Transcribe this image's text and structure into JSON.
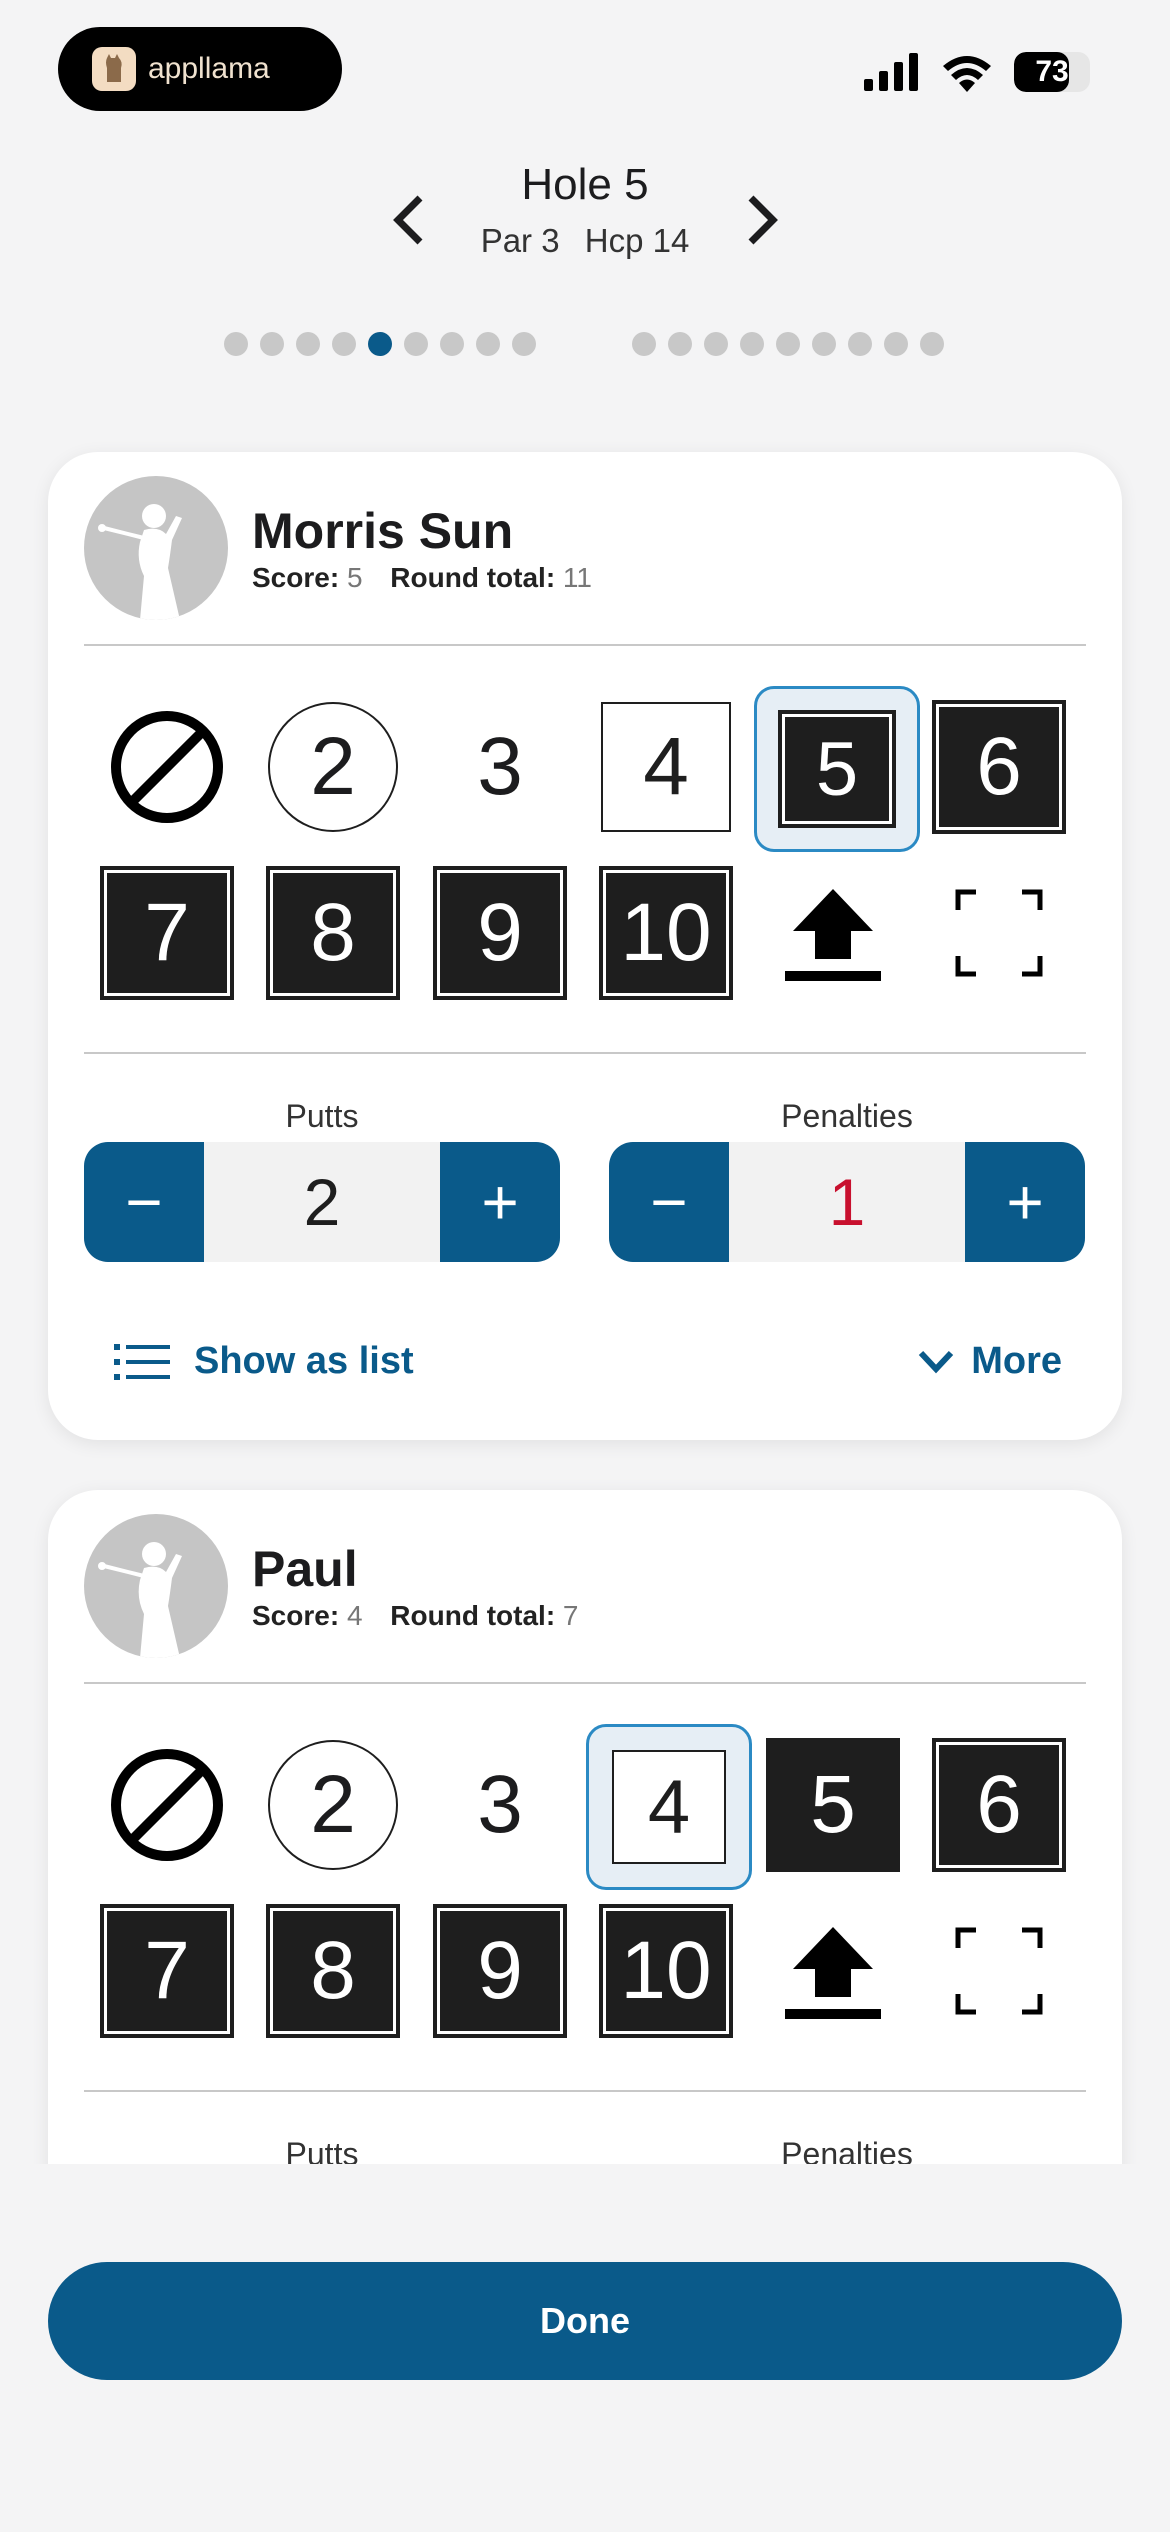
{
  "status": {
    "brand": "appllama",
    "battery": "73",
    "battery_level": 0.73
  },
  "hole": {
    "title": "Hole 5",
    "par": "Par 3",
    "hcp": "Hcp 14",
    "total_holes": 18,
    "current_index": 4
  },
  "players": [
    {
      "name": "Morris Sun",
      "score_label": "Score:",
      "score": "5",
      "round_label": "Round total:",
      "round_total": "11",
      "scores": [
        "2",
        "3",
        "4",
        "5",
        "6",
        "7",
        "8",
        "9",
        "10"
      ],
      "selected": "5",
      "putts_label": "Putts",
      "putts": "2",
      "penalties_label": "Penalties",
      "penalties": "1",
      "show_list": "Show as list",
      "more": "More"
    },
    {
      "name": "Paul",
      "score_label": "Score:",
      "score": "4",
      "round_label": "Round total:",
      "round_total": "7",
      "scores": [
        "2",
        "3",
        "4",
        "5",
        "6",
        "7",
        "8",
        "9",
        "10"
      ],
      "selected": "4",
      "putts_label": "Putts",
      "penalties_label": "Penalties"
    }
  ],
  "steppers": {
    "minus": "−",
    "plus": "+"
  },
  "done": "Done",
  "colors": {
    "accent": "#0a5a8a",
    "selected_border": "#2b8ac4",
    "penalty_red": "#c8102e"
  },
  "icons": [
    "no-score-icon",
    "pick-up-icon",
    "expand-icon",
    "list-icon",
    "chevron-down-icon",
    "golfer-avatar-icon"
  ]
}
